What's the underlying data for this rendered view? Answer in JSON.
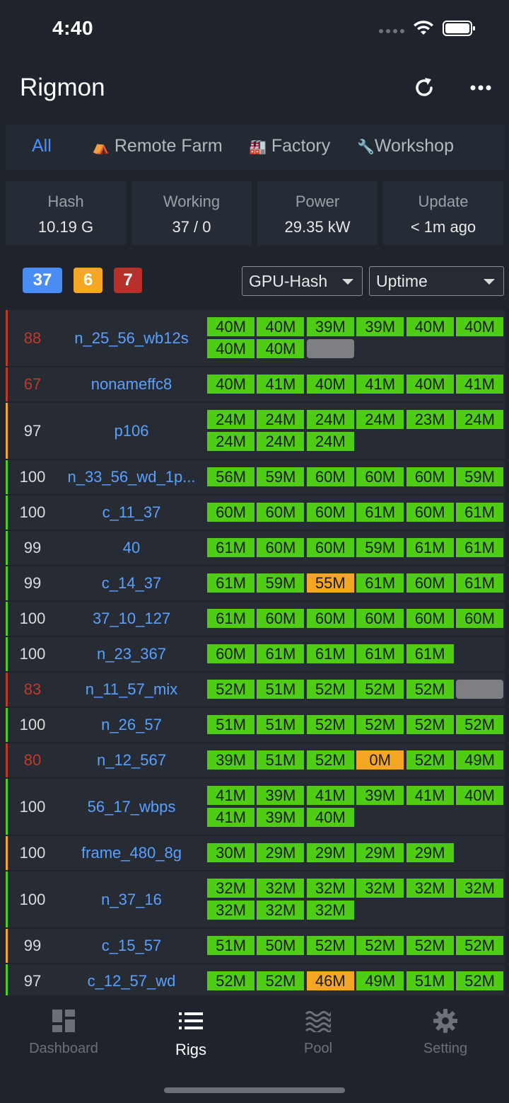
{
  "status_bar": {
    "time": "4:40"
  },
  "header": {
    "title": "Rigmon"
  },
  "tabs": [
    {
      "label": "All",
      "emoji": ""
    },
    {
      "label": "Remote Farm",
      "emoji": "⛺"
    },
    {
      "label": "Factory",
      "emoji": "🏭"
    },
    {
      "label": "Workshop",
      "emoji": "🔧"
    }
  ],
  "stats": [
    {
      "label": "Hash",
      "value": "10.19 G"
    },
    {
      "label": "Working",
      "value": "37 / 0"
    },
    {
      "label": "Power",
      "value": "29.35 kW"
    },
    {
      "label": "Update",
      "value": "< 1m ago"
    }
  ],
  "filters": {
    "badges": [
      {
        "value": "37",
        "color": "#4a8df5"
      },
      {
        "value": "6",
        "color": "#f5a623"
      },
      {
        "value": "7",
        "color": "#b8302a"
      }
    ],
    "sort_primary": "GPU-Hash",
    "sort_secondary": "Uptime"
  },
  "rigs": [
    {
      "pct": "88",
      "name": "n_25_56_wb12s",
      "status": "red",
      "gpus": [
        "40M",
        "40M",
        "39M",
        "39M",
        "40M",
        "40M",
        "40M",
        "40M",
        ""
      ]
    },
    {
      "pct": "67",
      "name": "nonameffc8",
      "status": "red",
      "gpus": [
        "40M",
        "41M",
        "40M",
        "41M",
        "40M",
        "41M"
      ]
    },
    {
      "pct": "97",
      "name": "p106",
      "status": "orange",
      "gpus": [
        "24M",
        "24M",
        "24M",
        "24M",
        "23M",
        "24M",
        "24M",
        "24M",
        "24M"
      ]
    },
    {
      "pct": "100",
      "name": "n_33_56_wd_1p...",
      "status": "green",
      "gpus": [
        "56M",
        "59M",
        "60M",
        "60M",
        "60M",
        "59M"
      ]
    },
    {
      "pct": "100",
      "name": "c_11_37",
      "status": "green",
      "gpus": [
        "60M",
        "60M",
        "60M",
        "61M",
        "60M",
        "61M"
      ]
    },
    {
      "pct": "99",
      "name": "40",
      "status": "green",
      "gpus": [
        "61M",
        "60M",
        "60M",
        "59M",
        "61M",
        "61M"
      ]
    },
    {
      "pct": "99",
      "name": "c_14_37",
      "status": "green",
      "gpus": [
        "61M",
        "59M",
        "55M",
        "61M",
        "60M",
        "61M"
      ]
    },
    {
      "pct": "100",
      "name": "37_10_127",
      "status": "green",
      "gpus": [
        "61M",
        "60M",
        "60M",
        "60M",
        "60M",
        "60M"
      ]
    },
    {
      "pct": "100",
      "name": "n_23_367",
      "status": "green",
      "gpus": [
        "60M",
        "61M",
        "61M",
        "61M",
        "61M"
      ]
    },
    {
      "pct": "83",
      "name": "n_11_57_mix",
      "status": "red",
      "gpus": [
        "52M",
        "51M",
        "52M",
        "52M",
        "52M",
        ""
      ]
    },
    {
      "pct": "100",
      "name": "n_26_57",
      "status": "green",
      "gpus": [
        "51M",
        "51M",
        "52M",
        "52M",
        "52M",
        "52M"
      ]
    },
    {
      "pct": "80",
      "name": "n_12_567",
      "status": "red",
      "gpus": [
        "39M",
        "51M",
        "52M",
        "0M",
        "52M",
        "49M"
      ]
    },
    {
      "pct": "100",
      "name": "56_17_wbps",
      "status": "green",
      "gpus": [
        "41M",
        "39M",
        "41M",
        "39M",
        "41M",
        "40M",
        "41M",
        "39M",
        "40M"
      ]
    },
    {
      "pct": "100",
      "name": "frame_480_8g",
      "status": "orange",
      "gpus": [
        "30M",
        "29M",
        "29M",
        "29M",
        "29M"
      ]
    },
    {
      "pct": "100",
      "name": "n_37_16",
      "status": "green",
      "gpus": [
        "32M",
        "32M",
        "32M",
        "32M",
        "32M",
        "32M",
        "32M",
        "32M",
        "32M"
      ]
    },
    {
      "pct": "99",
      "name": "c_15_57",
      "status": "orange",
      "gpus": [
        "51M",
        "50M",
        "52M",
        "52M",
        "52M",
        "52M"
      ]
    },
    {
      "pct": "97",
      "name": "c_12_57_wd",
      "status": "green",
      "gpus": [
        "52M",
        "52M",
        "46M",
        "49M",
        "51M",
        "52M"
      ]
    }
  ],
  "gpu_warn": [
    "55M",
    "0M",
    "46M"
  ],
  "nav": [
    {
      "label": "Dashboard",
      "icon": "dashboard-icon"
    },
    {
      "label": "Rigs",
      "icon": "list-icon"
    },
    {
      "label": "Pool",
      "icon": "waves-icon"
    },
    {
      "label": "Setting",
      "icon": "gear-icon"
    }
  ],
  "colors": {
    "accent": "#4a90ff",
    "ok": "#4fcc14",
    "warn": "#f5a623",
    "error": "#c2392b"
  }
}
